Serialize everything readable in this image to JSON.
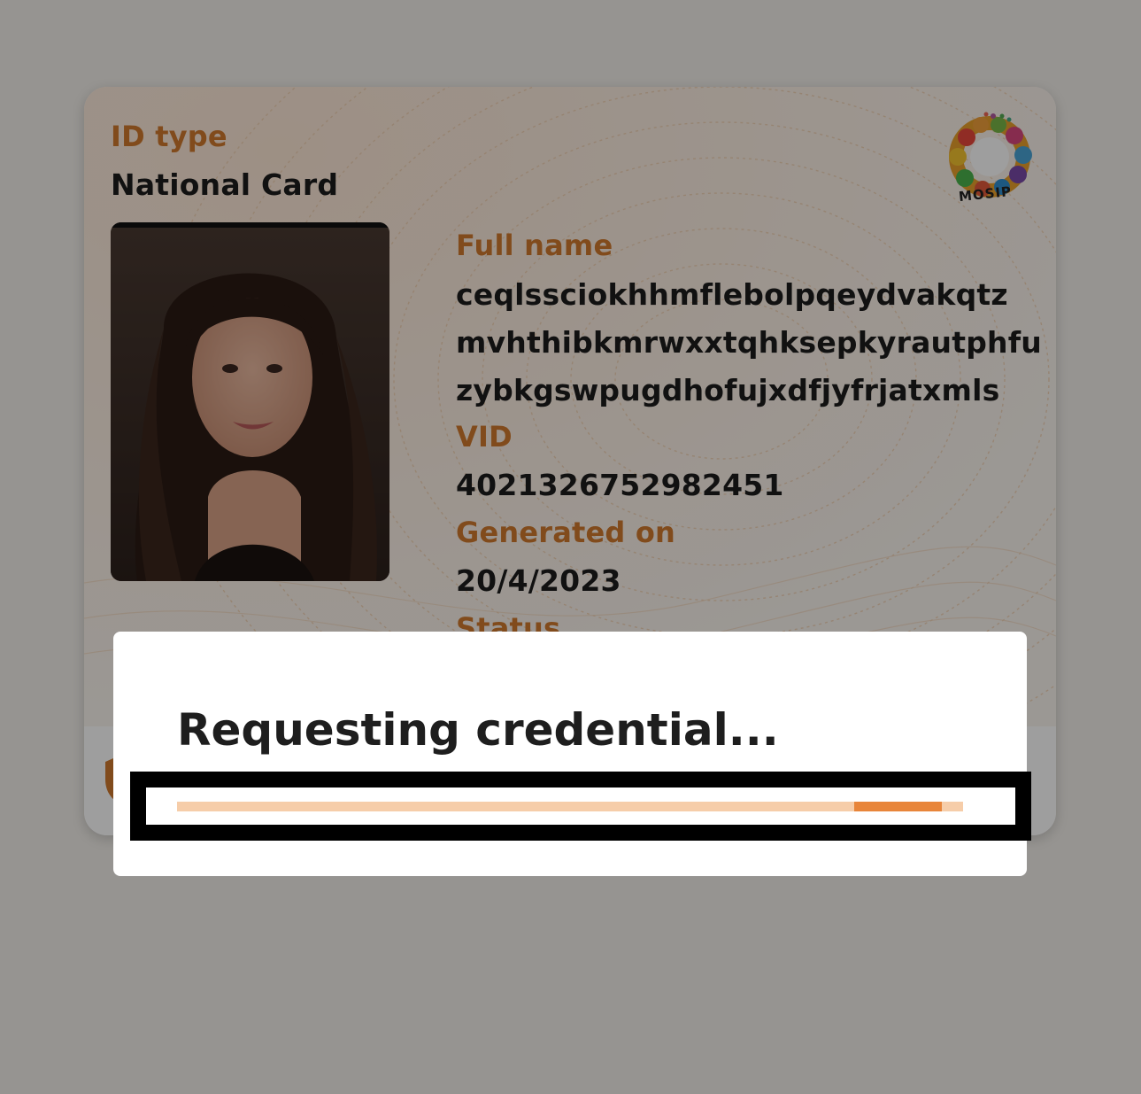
{
  "card": {
    "id_type_label": "ID type",
    "id_type_value": "National Card",
    "logo_text": "MOSIP",
    "full_name_label": "Full name",
    "full_name_lines": [
      "ceqlssciokhhmflebolpqeydvakqtz",
      "mvhthibkmrwxxtqhksepkyrautphfu",
      "zybkgswpugdhofujxdfjyfrjatxmls"
    ],
    "vid_label": "VID",
    "vid_value": "4021326752982451",
    "generated_on_label": "Generated on",
    "generated_on_value": "20/4/2023",
    "status_label": "Status"
  },
  "dialog": {
    "title": "Requesting credential...",
    "progress": {
      "indeterminate": true,
      "segment_start": 0.862,
      "segment_end": 0.973
    }
  },
  "colors": {
    "accent": "#d07a2e",
    "progress_fill": "#e8853a",
    "progress_track": "#f6cda9"
  }
}
